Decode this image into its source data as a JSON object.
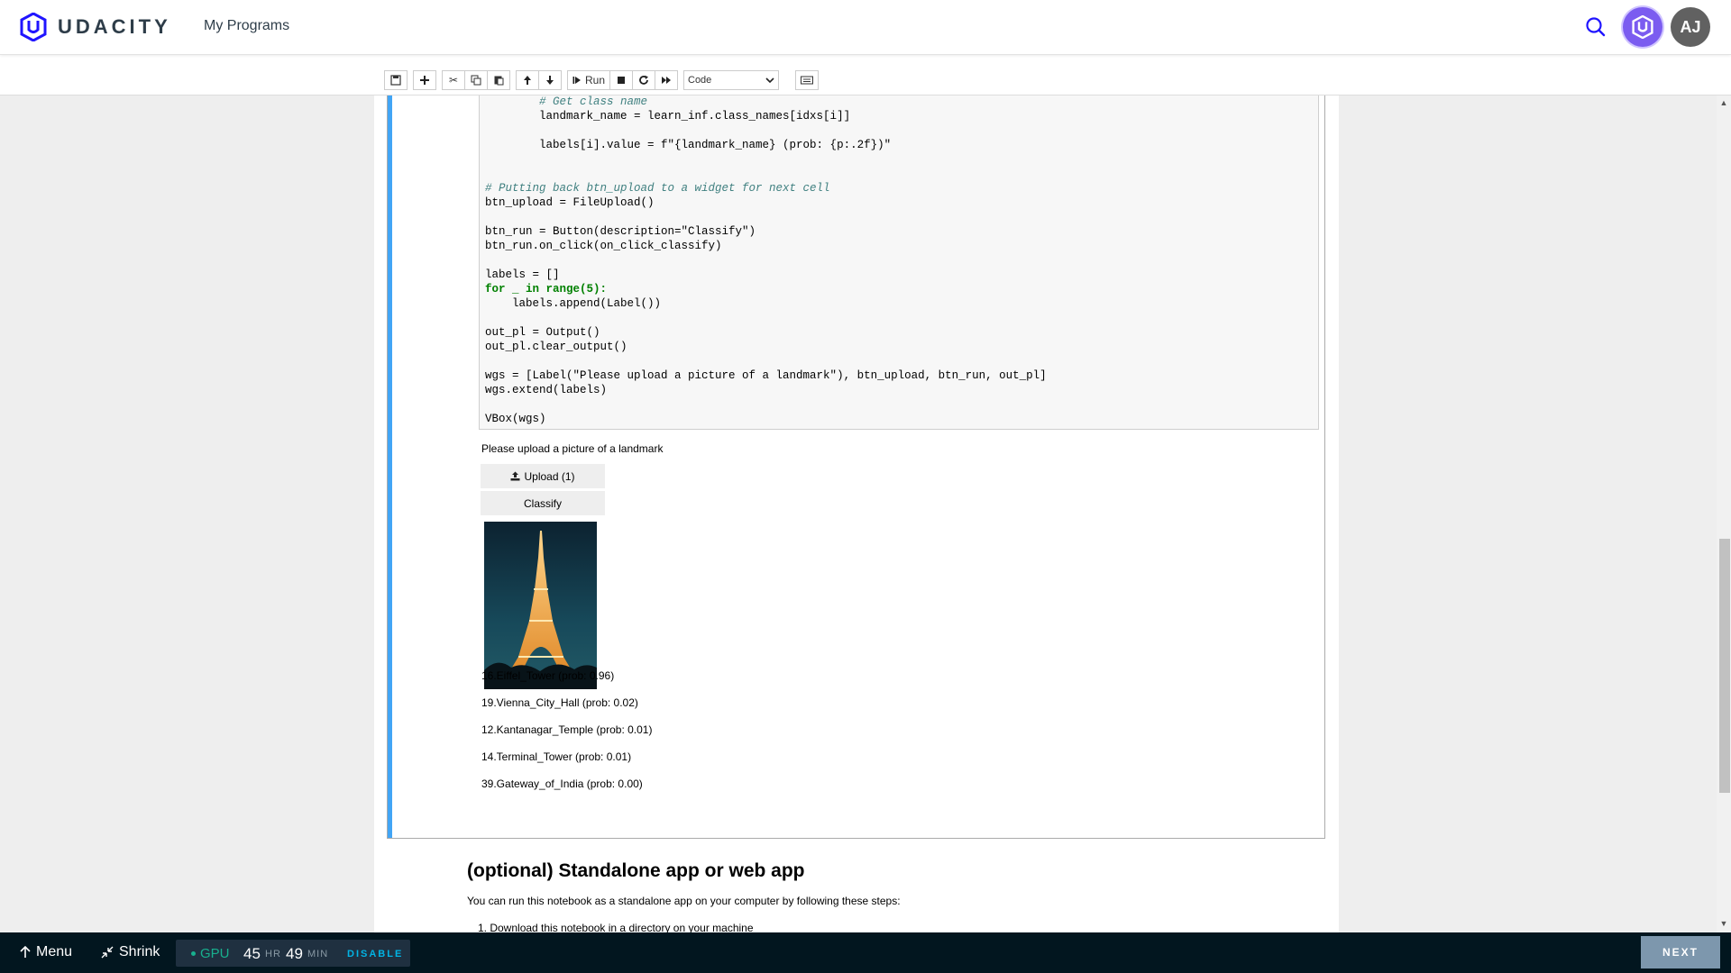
{
  "header": {
    "logo_text": "UDACITY",
    "nav_link": "My Programs",
    "avatar_initials": "AJ"
  },
  "toolbar": {
    "run_label": "Run",
    "cell_type": "Code"
  },
  "code_lines": [
    "        # Get class name",
    "        landmark_name = learn_inf.class_names[idxs[i]]",
    "",
    "        labels[i].value = f\"{landmark_name} (prob: {p:.2f})\"",
    "",
    "",
    "# Putting back btn_upload to a widget for next cell",
    "btn_upload = FileUpload()",
    "",
    "btn_run = Button(description=\"Classify\")",
    "btn_run.on_click(on_click_classify)",
    "",
    "labels = []",
    "for _ in range(5):",
    "    labels.append(Label())",
    "",
    "out_pl = Output()",
    "out_pl.clear_output()",
    "",
    "wgs = [Label(\"Please upload a picture of a landmark\"), btn_upload, btn_run, out_pl]",
    "wgs.extend(labels)",
    "",
    "VBox(wgs)"
  ],
  "output": {
    "prompt_label": "Please upload a picture of a landmark",
    "upload_button": "Upload (1)",
    "classify_button": "Classify",
    "predictions": [
      "16.Eiffel_Tower (prob: 0.96)",
      "19.Vienna_City_Hall (prob: 0.02)",
      "12.Kantanagar_Temple (prob: 0.01)",
      "14.Terminal_Tower (prob: 0.01)",
      "39.Gateway_of_India (prob: 0.00)"
    ]
  },
  "markdown": {
    "heading": "(optional) Standalone app or web app",
    "paragraph": "You can run this notebook as a standalone app on your computer by following these steps:",
    "list_item": "1. Download this notebook in a directory on your machine"
  },
  "bottom_bar": {
    "menu_label": "Menu",
    "shrink_label": "Shrink",
    "gpu_label": "GPU",
    "hours": "45",
    "hours_unit": "HR",
    "minutes": "49",
    "minutes_unit": "MIN",
    "disable_label": "DISABLE",
    "next_label": "NEXT"
  },
  "colors": {
    "brand": "#7b5cf0",
    "cell_selected_bar": "#42a5f5",
    "gpu_active": "#18b08e",
    "link_blue": "#02b3e4",
    "next_button": "#7d97ad"
  }
}
